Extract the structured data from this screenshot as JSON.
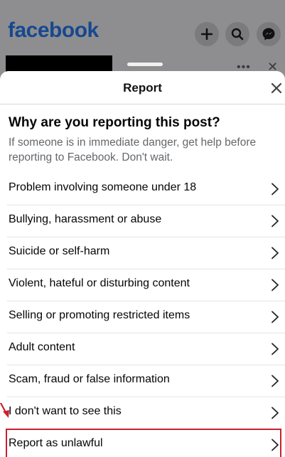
{
  "background_app": {
    "logo_text": "facebook",
    "header_icons": [
      "plus-icon",
      "search-icon",
      "messenger-icon"
    ],
    "post_icons": [
      "more-icon",
      "close-icon"
    ]
  },
  "sheet": {
    "title": "Report",
    "close_icon": "close-icon",
    "question": "Why are you reporting this post?",
    "subtext": "If someone is in immediate danger, get help before reporting to Facebook. Don't wait.",
    "options": [
      {
        "label": "Problem involving someone under 18",
        "highlighted": false
      },
      {
        "label": "Bullying, harassment or abuse",
        "highlighted": false
      },
      {
        "label": "Suicide or self-harm",
        "highlighted": false
      },
      {
        "label": "Violent, hateful or disturbing content",
        "highlighted": false
      },
      {
        "label": "Selling or promoting restricted items",
        "highlighted": false
      },
      {
        "label": "Adult content",
        "highlighted": false
      },
      {
        "label": "Scam, fraud or false information",
        "highlighted": false
      },
      {
        "label": "I don't want to see this",
        "highlighted": false
      },
      {
        "label": "Report as unlawful",
        "highlighted": true
      }
    ]
  },
  "colors": {
    "brand": "#17488f",
    "highlight_box": "#cc1f2e",
    "secondary_text": "#65676b"
  }
}
